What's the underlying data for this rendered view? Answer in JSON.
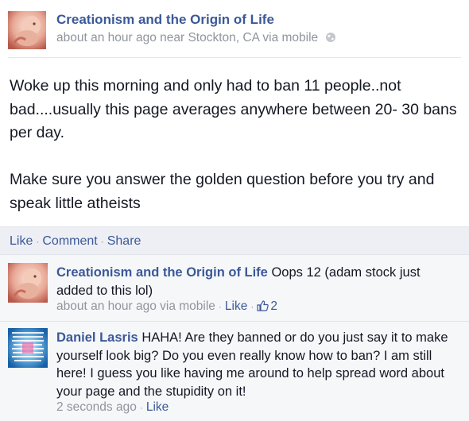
{
  "post": {
    "page_name": "Creationism and the Origin of Life",
    "meta": "about an hour ago near Stockton, CA via mobile",
    "paragraphs": [
      "Woke up this morning and only had to ban 11 people..not bad....usually this page averages anywhere between 20- 30 bans per day.",
      "Make sure you answer the golden question before you try and speak little atheists"
    ],
    "icon": "globe-icon"
  },
  "actions": {
    "like": "Like",
    "comment": "Comment",
    "share": "Share",
    "separator": "·"
  },
  "comments": [
    {
      "author": "Creationism and the Origin of Life",
      "text": "Oops 12 (adam stock just added to this lol)",
      "time": "about an hour ago via mobile",
      "like": "Like",
      "like_count": "2",
      "icon": "thumbs-up-icon"
    },
    {
      "author": "Daniel Lasris",
      "text": "HAHA! Are they banned or do you just say it to make yourself look big? Do you even really know how to ban? I am still here! I guess you like having me around to help spread word about your page and the stupidity on it!",
      "time": "2 seconds ago",
      "like": "Like"
    }
  ],
  "colors": {
    "link": "#3b5998",
    "muted": "#90949c",
    "bar_bg": "#edeff4",
    "comment_bg": "#f6f7f9"
  }
}
